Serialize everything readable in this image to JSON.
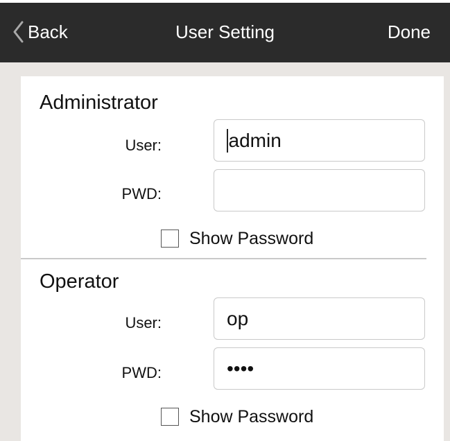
{
  "header": {
    "back_label": "Back",
    "title": "User Setting",
    "done_label": "Done"
  },
  "administrator": {
    "title": "Administrator",
    "user_label": "User:",
    "user_value": "admin",
    "pwd_label": "PWD:",
    "pwd_value": "",
    "show_password_label": "Show Password",
    "show_password_checked": false
  },
  "operator": {
    "title": "Operator",
    "user_label": "User:",
    "user_value": "op",
    "pwd_label": "PWD:",
    "pwd_value": "••••",
    "show_password_label": "Show Password",
    "show_password_checked": false
  },
  "colors": {
    "header_bg": "#2b2b2b",
    "page_bg": "#e9e6e3",
    "card_bg": "#ffffff",
    "input_border": "#c9c9c9"
  }
}
